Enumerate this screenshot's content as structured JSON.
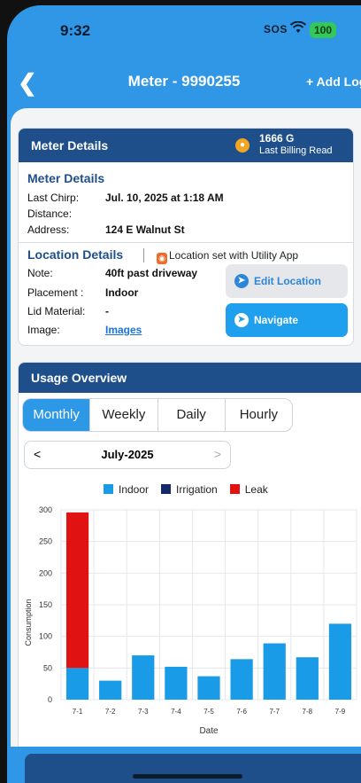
{
  "status_bar": {
    "time": "9:32",
    "sos": "SOS",
    "battery": "100"
  },
  "nav": {
    "title": "Meter - 9990255",
    "add_log": "+ Add Log"
  },
  "meter_card": {
    "header": "Meter Details",
    "billing_value": "1666 G",
    "billing_label": "Last Billing Read",
    "section_title": "Meter Details",
    "last_chirp_label": "Last Chirp:",
    "last_chirp_value": "Jul. 10, 2025 at 1:18 AM",
    "distance_label": "Distance:",
    "distance_value": "",
    "address_label": "Address:",
    "address_value": "124 E Walnut St",
    "location_title": "Location Details",
    "location_badge": "Location set with Utility App",
    "note_label": "Note:",
    "note_value": "40ft past driveway",
    "placement_label": "Placement :",
    "placement_value": "Indoor",
    "lid_label": "Lid Material:",
    "lid_value": "-",
    "image_label": "Image:",
    "image_link": "Images",
    "edit_button": "Edit Location",
    "navigate_button": "Navigate"
  },
  "usage": {
    "header": "Usage Overview",
    "tabs": [
      "Monthly",
      "Weekly",
      "Daily",
      "Hourly"
    ],
    "active_tab": "Monthly",
    "period": "July-2025",
    "prev": "<",
    "next": ">"
  },
  "colors": {
    "indoor": "#1a9be8",
    "irrigation": "#14296b",
    "leak": "#e11212",
    "brand": "#1e4f8a"
  },
  "chart_data": {
    "type": "bar",
    "stacked": true,
    "categories": [
      "7-1",
      "7-2",
      "7-3",
      "7-4",
      "7-5",
      "7-6",
      "7-7",
      "7-8",
      "7-9"
    ],
    "series": [
      {
        "name": "Indoor",
        "values": [
          50,
          30,
          70,
          52,
          37,
          64,
          89,
          67,
          120
        ]
      },
      {
        "name": "Irrigation",
        "values": [
          0,
          0,
          0,
          0,
          0,
          0,
          0,
          0,
          0
        ]
      },
      {
        "name": "Leak",
        "values": [
          246,
          0,
          0,
          0,
          0,
          0,
          0,
          0,
          0
        ]
      }
    ],
    "xlabel": "Date",
    "ylabel": "Consumption",
    "yticks": [
      0,
      50,
      100,
      150,
      200,
      250,
      300
    ],
    "ylim": [
      0,
      300
    ],
    "grid": true,
    "legend": "top"
  }
}
